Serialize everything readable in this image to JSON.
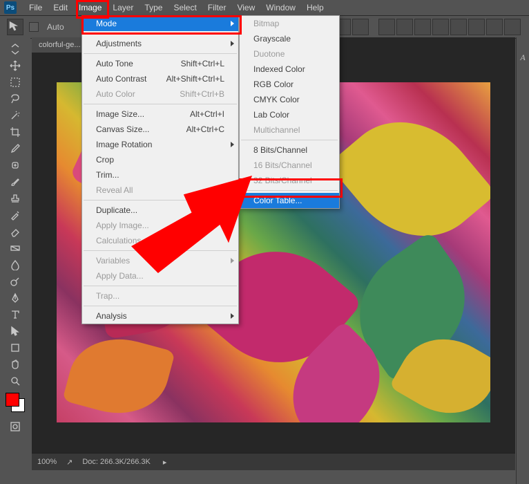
{
  "app": {
    "logo_text": "Ps"
  },
  "menubar": [
    "File",
    "Edit",
    "Image",
    "Layer",
    "Type",
    "Select",
    "Filter",
    "View",
    "Window",
    "Help"
  ],
  "options": {
    "auto_checkbox_label": "Auto"
  },
  "document": {
    "tab_label": "colorful-ge..."
  },
  "status": {
    "zoom": "100%",
    "doc_info": "Doc: 266.3K/266.3K"
  },
  "image_menu": {
    "mode": "Mode",
    "adjustments": "Adjustments",
    "auto_tone": "Auto Tone",
    "auto_tone_sc": "Shift+Ctrl+L",
    "auto_contrast": "Auto Contrast",
    "auto_contrast_sc": "Alt+Shift+Ctrl+L",
    "auto_color": "Auto Color",
    "auto_color_sc": "Shift+Ctrl+B",
    "image_size": "Image Size...",
    "image_size_sc": "Alt+Ctrl+I",
    "canvas_size": "Canvas Size...",
    "canvas_size_sc": "Alt+Ctrl+C",
    "image_rotation": "Image Rotation",
    "crop": "Crop",
    "trim": "Trim...",
    "reveal_all": "Reveal All",
    "duplicate": "Duplicate...",
    "apply_image": "Apply Image...",
    "calculations": "Calculations...",
    "variables": "Variables",
    "apply_data": "Apply Data...",
    "trap": "Trap...",
    "analysis": "Analysis"
  },
  "mode_menu": {
    "bitmap": "Bitmap",
    "grayscale": "Grayscale",
    "duotone": "Duotone",
    "indexed": "Indexed Color",
    "rgb": "RGB Color",
    "cmyk": "CMYK Color",
    "lab": "Lab Color",
    "multichannel": "Multichannel",
    "bits8": "8 Bits/Channel",
    "bits16": "16 Bits/Channel",
    "bits32": "32 Bits/Channel",
    "color_table": "Color Table..."
  },
  "icons": {
    "move": "move",
    "marquee": "marquee",
    "lasso": "lasso",
    "wand": "wand",
    "crop": "crop",
    "eyedrop": "eyedrop",
    "heal": "heal",
    "brush": "brush",
    "stamp": "stamp",
    "history": "history",
    "eraser": "eraser",
    "gradient": "gradient",
    "blur": "blur",
    "dodge": "dodge",
    "pen": "pen",
    "type": "type",
    "path": "path",
    "shape": "shape",
    "hand": "hand",
    "zoom": "zoom"
  },
  "colors": {
    "accent": "#1a7bdc",
    "highlight": "#ff0000"
  }
}
